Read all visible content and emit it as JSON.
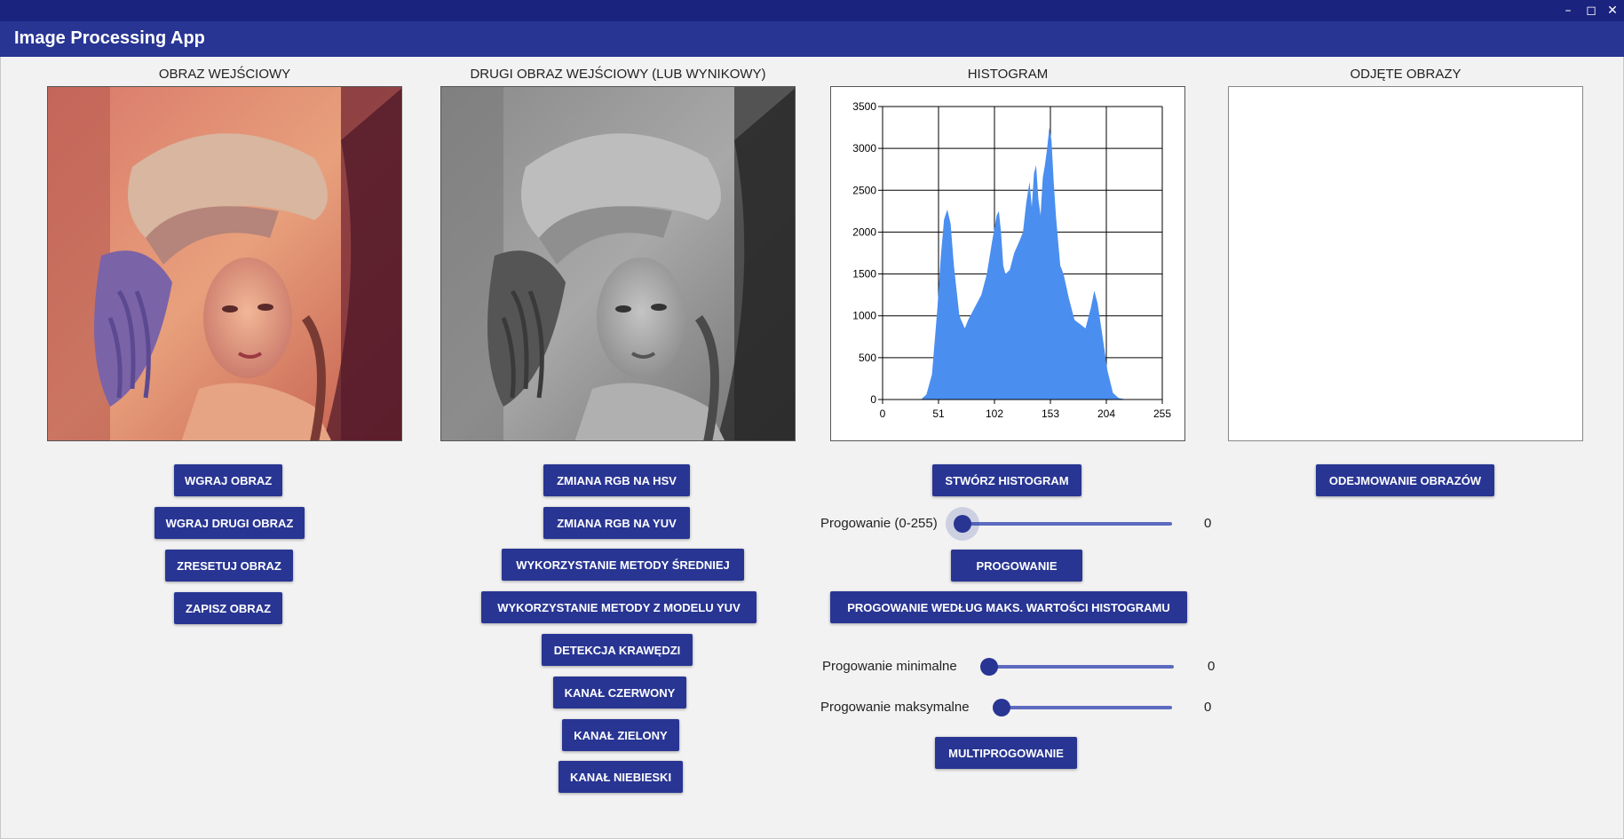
{
  "app": {
    "title": "Image Processing App"
  },
  "window_controls": {
    "minimize": "–",
    "maximize": "◻",
    "close": "✕"
  },
  "panels": {
    "input": {
      "caption": "OBRAZ WEJŚCIOWY"
    },
    "second": {
      "caption": "DRUGI OBRAZ WEJŚCIOWY (LUB WYNIKOWY)"
    },
    "histogram": {
      "caption": "HISTOGRAM"
    },
    "subtracted": {
      "caption": "ODJĘTE OBRAZY"
    }
  },
  "buttons": {
    "load_image": "WGRAJ OBRAZ",
    "load_second": "WGRAJ DRUGI OBRAZ",
    "reset_image": "ZRESETUJ OBRAZ",
    "save_image": "ZAPISZ OBRAZ",
    "rgb_to_hsv": "ZMIANA RGB NA HSV",
    "rgb_to_yuv": "ZMIANA RGB NA YUV",
    "mean_method": "WYKORZYSTANIE METODY ŚREDNIEJ",
    "yuv_method": "WYKORZYSTANIE METODY Z MODELU YUV",
    "edge_detection": "DETEKCJA KRAWĘDZI",
    "red_channel": "KANAŁ CZERWONY",
    "green_channel": "KANAŁ ZIELONY",
    "blue_channel": "KANAŁ NIEBIESKI",
    "create_histogram": "STWÓRZ HISTOGRAM",
    "thresholding": "PROGOWANIE",
    "threshold_by_max": "PROGOWANIE WEDŁUG MAKS. WARTOŚCI HISTOGRAMU",
    "multithresholding": "MULTIPROGOWANIE",
    "subtract_images": "ODEJMOWANIE OBRAZÓW"
  },
  "sliders": {
    "threshold": {
      "label": "Progowanie (0-255)",
      "value": "0"
    },
    "min_threshold": {
      "label": "Progowanie minimalne",
      "value": "0"
    },
    "max_threshold": {
      "label": "Progowanie maksymalne",
      "value": "0"
    }
  },
  "chart_data": {
    "type": "area",
    "title": "",
    "xlabel": "",
    "ylabel": "",
    "color": "#4a8ef0",
    "xlim": [
      0,
      255
    ],
    "ylim": [
      0,
      3500
    ],
    "xticks": [
      "0",
      "51",
      "102",
      "153",
      "204",
      "255"
    ],
    "yticks": [
      "0",
      "500",
      "1000",
      "1500",
      "2000",
      "2500",
      "3000",
      "3500"
    ],
    "grid": true,
    "x": [
      35,
      40,
      45,
      50,
      53,
      56,
      59,
      62,
      65,
      70,
      75,
      78,
      82,
      86,
      90,
      95,
      100,
      104,
      106,
      108,
      110,
      112,
      116,
      120,
      125,
      128,
      131,
      134,
      136,
      138,
      140,
      142,
      144,
      146,
      148,
      150,
      152,
      154,
      156,
      158,
      160,
      162,
      165,
      170,
      175,
      180,
      185,
      190,
      193,
      196,
      200,
      205,
      210,
      215,
      220,
      225
    ],
    "y": [
      0,
      60,
      300,
      1100,
      1700,
      2150,
      2270,
      2100,
      1600,
      1000,
      850,
      950,
      1050,
      1150,
      1250,
      1500,
      1900,
      2200,
      2250,
      2000,
      1600,
      1500,
      1550,
      1750,
      1900,
      2000,
      2350,
      2600,
      2300,
      2700,
      2800,
      2400,
      2200,
      2650,
      2800,
      3000,
      3250,
      3100,
      2600,
      2200,
      1900,
      1600,
      1500,
      1200,
      950,
      900,
      850,
      1100,
      1300,
      1150,
      800,
      350,
      80,
      20,
      5,
      0
    ]
  }
}
